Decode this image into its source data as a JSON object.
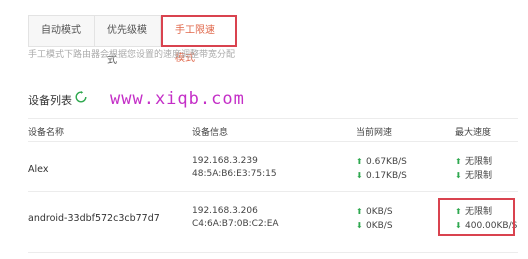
{
  "tabs": [
    {
      "label": "自动模式"
    },
    {
      "label": "优先级模式"
    },
    {
      "label": "手工限速模式"
    }
  ],
  "description": "手工模式下路由器会根据您设置的速度调整带宽分配",
  "device_list": {
    "title": "设备列表",
    "columns": {
      "name": "设备名称",
      "info": "设备信息",
      "current_speed": "当前网速",
      "max_speed": "最大速度"
    },
    "rows": [
      {
        "name": "Alex",
        "ip": "192.168.3.239",
        "mac": "48:5A:B6:E3:75:15",
        "upload": "0.67KB/S",
        "download": "0.17KB/S",
        "max_upload": "无限制",
        "max_download": "无限制"
      },
      {
        "name": "android-33dbf572c3cb77d7",
        "ip": "192.168.3.206",
        "mac": "C4:6A:B7:0B:C2:EA",
        "upload": "0KB/S",
        "download": "0KB/S",
        "max_upload": "无限制",
        "max_download": "400.00KB/S"
      }
    ]
  },
  "watermark": "www.xiqb.com",
  "colors": {
    "accent": "#e0674a",
    "highlight_border": "#d9434f",
    "arrow": "#2fa84f",
    "watermark": "#c42fc7"
  },
  "icons": {
    "refresh": "refresh-icon",
    "upload": "arrow-up-icon",
    "download": "arrow-down-icon"
  }
}
